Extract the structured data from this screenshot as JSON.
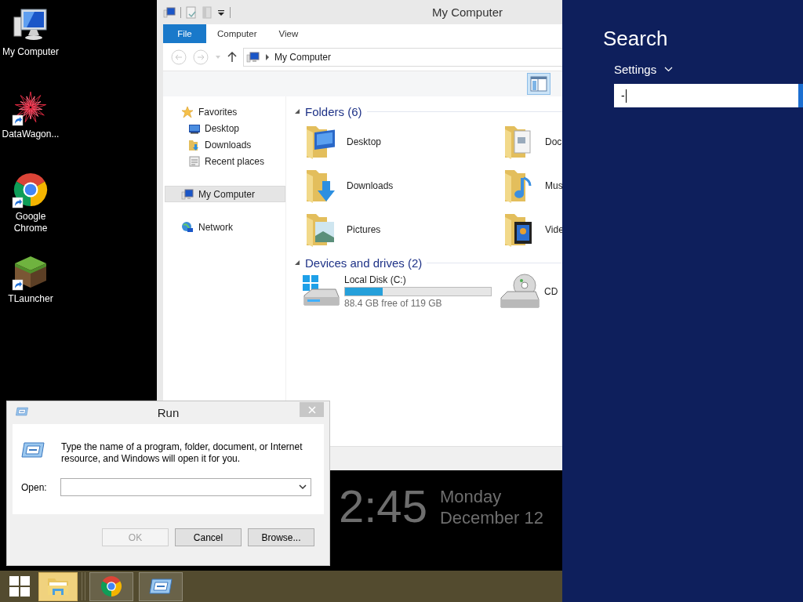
{
  "desktop_icons": [
    {
      "label": "My Computer",
      "kind": "computer",
      "shortcut": false
    },
    {
      "label": "DataWagon...",
      "kind": "mandala",
      "shortcut": true
    },
    {
      "label": "Google Chrome",
      "kind": "browser",
      "shortcut": true
    },
    {
      "label": "TLauncher",
      "kind": "block",
      "shortcut": true
    }
  ],
  "explorer": {
    "title": "My Computer",
    "ribbon_tabs": [
      {
        "label": "File",
        "kind": "menu",
        "selected": false
      },
      {
        "label": "Computer",
        "kind": "tab",
        "selected": false
      },
      {
        "label": "View",
        "kind": "tab",
        "selected": false
      }
    ],
    "address": {
      "path": "My Computer"
    },
    "nav": [
      {
        "label": "Favorites",
        "kind": "star",
        "selected": false,
        "children": [
          {
            "label": "Desktop",
            "kind": "desktop",
            "selected": false
          },
          {
            "label": "Downloads",
            "kind": "downloads",
            "selected": false
          },
          {
            "label": "Recent places",
            "kind": "recent",
            "selected": false
          }
        ]
      },
      {
        "label": "My Computer",
        "kind": "computer",
        "selected": true
      },
      {
        "label": "Network",
        "kind": "network",
        "selected": false
      }
    ],
    "groups": [
      {
        "title": "Folders (6)",
        "expanded": true,
        "items": [
          {
            "label": "Desktop",
            "kind": "desktop"
          },
          {
            "label": "Doc",
            "kind": "documents"
          },
          {
            "label": "Downloads",
            "kind": "downloads"
          },
          {
            "label": "Mus",
            "kind": "music"
          },
          {
            "label": "Pictures",
            "kind": "pictures"
          },
          {
            "label": "Vide",
            "kind": "videos"
          }
        ]
      },
      {
        "title": "Devices and drives (2)",
        "expanded": true,
        "items": [
          {
            "label": "Local Disk (C:)",
            "kind": "disk",
            "level": 0.26,
            "detail": "88.4 GB free of 119 GB"
          },
          {
            "label": "CD",
            "kind": "cd"
          }
        ]
      }
    ]
  },
  "search_pane": {
    "title": "Search",
    "scope": "Settings",
    "query": "-"
  },
  "run_dialog": {
    "title": "Run",
    "message": "Type the name of a program, folder, document, or Internet resource, and Windows will open it for you.",
    "open_label": "Open:",
    "buttons": [
      {
        "label": "OK",
        "disabled": true
      },
      {
        "label": "Cancel",
        "disabled": false
      },
      {
        "label": "Browse...",
        "disabled": false
      }
    ]
  },
  "lock_overlay": {
    "time": "2:45",
    "day": "Monday",
    "date": "December 12"
  },
  "taskbar": {
    "items": [
      {
        "kind": "explorer",
        "selected": true
      },
      {
        "kind": "browser",
        "selected": false
      },
      {
        "kind": "run",
        "selected": false
      }
    ]
  }
}
